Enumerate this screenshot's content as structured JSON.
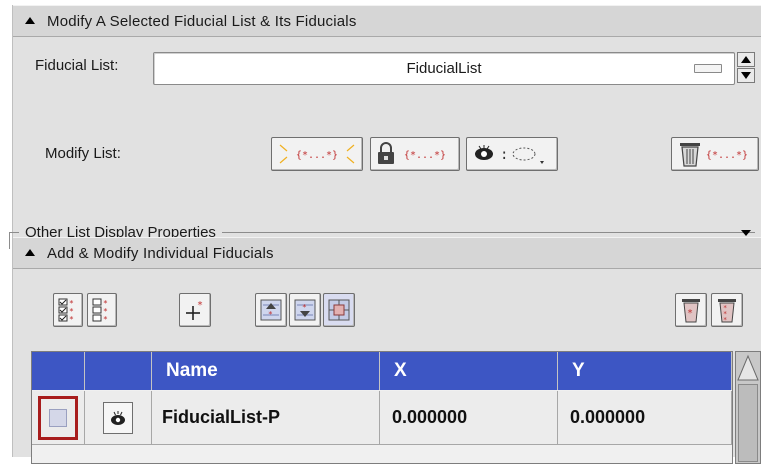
{
  "section1": {
    "title": "Modify A Selected Fiducial List & Its Fiducials",
    "fiducial_list_label": "Fiducial List:",
    "fiducial_list_value": "FiducialList",
    "modify_list_label": "Modify List:",
    "modify_tools": [
      "select-all-list-icon",
      "lock-list-icon",
      "visibility-toggle-icon",
      "delete-list-icon"
    ],
    "other_props_label": "Other List Display Properties"
  },
  "section2": {
    "title": "Add & Modify Individual Fiducials",
    "toolbar": [
      "select-all-icon",
      "deselect-all-icon",
      "add-fiducial-icon",
      "move-up-icon",
      "move-down-icon",
      "center-icon",
      "delete-selected-icon",
      "delete-all-icon"
    ]
  },
  "table": {
    "columns": [
      "",
      "",
      "Name",
      "X",
      "Y"
    ],
    "rows": [
      {
        "name": "FiducialList-P",
        "x": "0.000000",
        "y": "0.000000",
        "selected": false,
        "visible": true
      }
    ]
  },
  "colors": {
    "header_blue": "#3d56c4",
    "highlight_red": "#a81d1d"
  }
}
